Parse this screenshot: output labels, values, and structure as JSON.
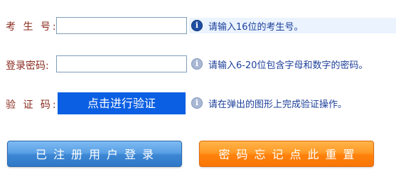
{
  "form": {
    "exam_number": {
      "label": "考 生 号:",
      "value": "",
      "placeholder": "",
      "hint": "请输入16位的考生号。"
    },
    "password": {
      "label": "登录密码:",
      "value": "",
      "placeholder": "",
      "hint": "请输入6-20位包含字母和数字的密码。"
    },
    "captcha": {
      "label": "验 证 码:",
      "button_label": "点击进行验证",
      "hint": "请在弹出的图形上完成验证操作。"
    }
  },
  "actions": {
    "login_label": "已注册用户登录",
    "reset_label": "密码忘记点此重置"
  },
  "icons": {
    "hint_icon": "info-icon",
    "hint_glyph": "i"
  },
  "colors": {
    "label_text": "#8a2b1f",
    "hint_text": "#1c3f9a",
    "hint_highlight_bg": "#eaf3fe",
    "captcha_button_bg": "#0b5fe3",
    "login_button": "#3c86d4",
    "reset_button": "#ff8a12"
  }
}
